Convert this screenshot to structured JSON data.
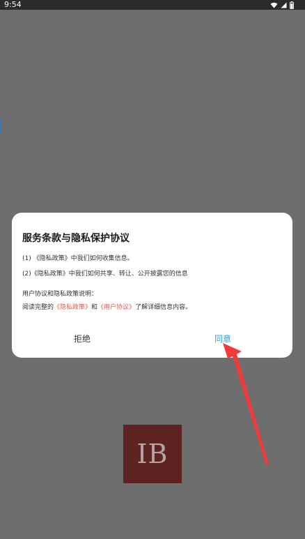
{
  "status_bar": {
    "time": "9:54",
    "icons": [
      "wifi-icon",
      "signal-icon",
      "battery-icon"
    ]
  },
  "dialog": {
    "title": "服务条款与隐私保护协议",
    "line1": "(1) 《隐私政策》中我们如何收集信息。",
    "line2": "(2)《隐私政策》中我们如何共享、转让、公开披露您的信息",
    "line3": "用户协议和隐私政策说明：",
    "line4": {
      "prefix": "阅读完整的",
      "privacy_link": "《隐私政策》",
      "conjunction": "和",
      "user_link": "《用户协议》",
      "suffix": "了解详细信息内容。"
    },
    "reject_label": "拒绝",
    "agree_label": "同意"
  },
  "logo": {
    "text": "IB"
  },
  "colors": {
    "overlay": "#6e6e6e",
    "agree": "#2b9fd8",
    "link": "#e05a4e",
    "arrow": "#f23a3a",
    "logo_bg": "#5e2424"
  }
}
